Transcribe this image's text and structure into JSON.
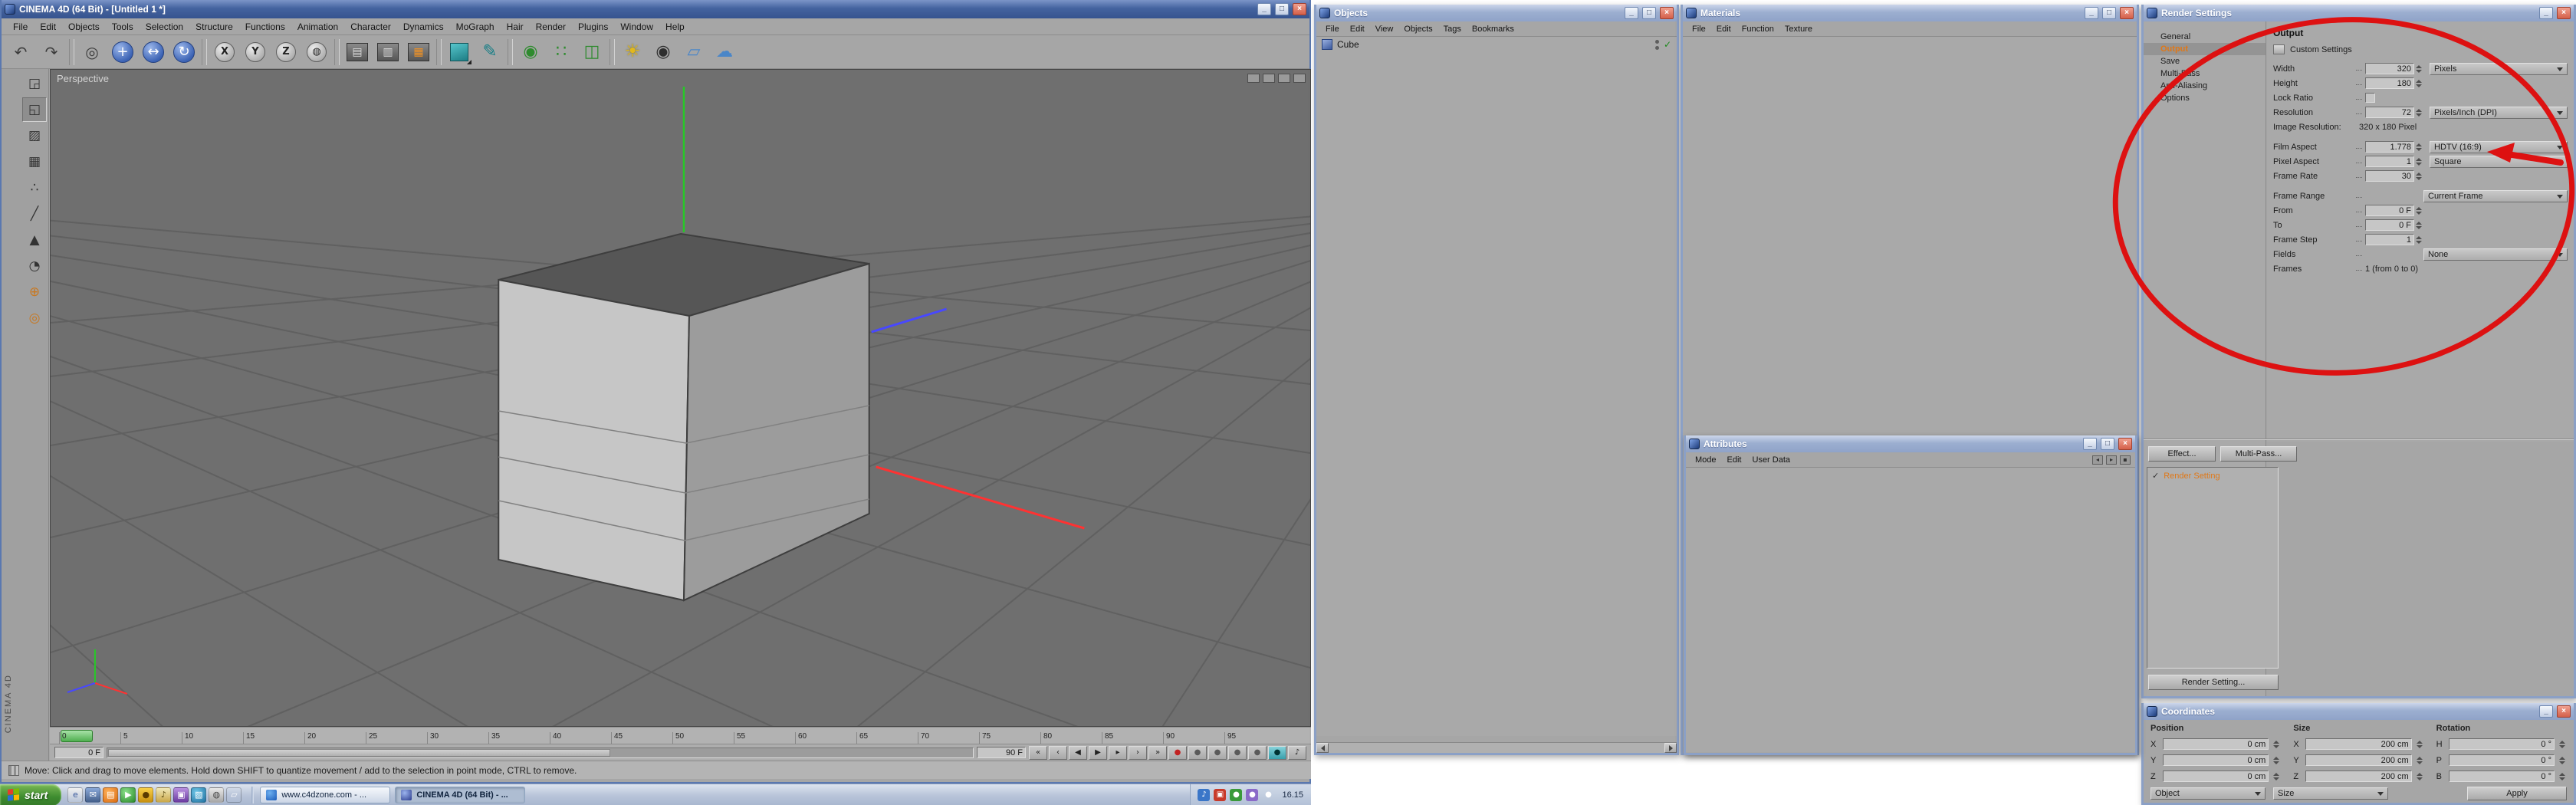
{
  "chrome": {
    "minimize_glyph": "_",
    "maximize_glyph": "□",
    "close_glyph": "×"
  },
  "icons": {
    "check": "✓"
  },
  "main_window": {
    "title": "CINEMA 4D (64 Bit) - [Untitled 1 *]",
    "menu_items": [
      "File",
      "Edit",
      "Objects",
      "Tools",
      "Selection",
      "Structure",
      "Functions",
      "Animation",
      "Character",
      "Dynamics",
      "MoGraph",
      "Hair",
      "Render",
      "Plugins",
      "Window",
      "Help"
    ],
    "toolbar_icons": [
      {
        "name": "undo-icon",
        "glyph": "↶"
      },
      {
        "name": "redo-icon",
        "glyph": "↷"
      },
      {
        "name": "separator",
        "glyph": "",
        "tint": "sep",
        "inter": "false"
      },
      {
        "name": "live-selection-icon",
        "glyph": "◎"
      },
      {
        "name": "move-tool-icon",
        "glyph": "+",
        "tint": "blue"
      },
      {
        "name": "scale-tool-icon",
        "glyph": "↔",
        "tint": "blue"
      },
      {
        "name": "rotate-tool-icon",
        "glyph": "↻",
        "tint": "blue"
      },
      {
        "name": "separator",
        "glyph": "",
        "tint": "sep",
        "inter": "false"
      },
      {
        "name": "x-axis-lock-icon",
        "glyph": "X",
        "tint": "ring"
      },
      {
        "name": "y-axis-lock-icon",
        "glyph": "Y",
        "tint": "ring"
      },
      {
        "name": "z-axis-lock-icon",
        "glyph": "Z",
        "tint": "ring"
      },
      {
        "name": "coordinate-system-icon",
        "glyph": "◍",
        "tint": "ring"
      },
      {
        "name": "separator",
        "glyph": "",
        "tint": "sep",
        "inter": "false"
      },
      {
        "name": "render-view-icon",
        "glyph": "▤",
        "tint": "render"
      },
      {
        "name": "render-picture-viewer-icon",
        "glyph": "▥",
        "tint": "render"
      },
      {
        "name": "render-settings-icon",
        "glyph": "▦",
        "tint": "render-orange"
      },
      {
        "name": "separator",
        "glyph": "",
        "tint": "sep",
        "inter": "false"
      },
      {
        "name": "cube-primitive-icon",
        "glyph": "■",
        "tint": "teal-cube"
      },
      {
        "name": "spline-pen-icon",
        "glyph": "✎",
        "tint": "teal"
      },
      {
        "name": "separator",
        "glyph": "",
        "tint": "sep",
        "inter": "false"
      },
      {
        "name": "hypernurbs-icon",
        "glyph": "◉",
        "tint": "green"
      },
      {
        "name": "array-icon",
        "glyph": "∷",
        "tint": "green"
      },
      {
        "name": "instance-icon",
        "glyph": "◫",
        "tint": "green"
      },
      {
        "name": "separator",
        "glyph": "",
        "tint": "sep",
        "inter": "false"
      },
      {
        "name": "light-icon",
        "glyph": "☀",
        "tint": "yellow"
      },
      {
        "name": "camera-icon",
        "glyph": "◉",
        "tint": "dark"
      },
      {
        "name": "floor-icon",
        "glyph": "▱",
        "tint": "sky"
      },
      {
        "name": "sky-icon",
        "glyph": "☁",
        "tint": "sky"
      }
    ],
    "left_toolbar_icons": [
      {
        "name": "make-editable-icon",
        "glyph": "◲"
      },
      {
        "name": "model-mode-icon",
        "glyph": "◱",
        "tint": "active"
      },
      {
        "name": "texture-mode-icon",
        "glyph": "▨"
      },
      {
        "name": "workplane-mode-icon",
        "glyph": "▦"
      },
      {
        "name": "points-mode-icon",
        "glyph": "∴"
      },
      {
        "name": "edges-mode-icon",
        "glyph": "╱"
      },
      {
        "name": "polygons-mode-icon",
        "glyph": "▲"
      },
      {
        "name": "animation-mode-icon",
        "glyph": "◔"
      },
      {
        "name": "axis-mode-icon",
        "glyph": "⊕",
        "tint": "orange"
      },
      {
        "name": "snap-settings-icon",
        "glyph": "◎",
        "tint": "orange"
      }
    ],
    "viewport": {
      "label": "Perspective"
    },
    "vertical_brand": "CINEMA 4D",
    "timeline_ticks": [
      "0",
      "5",
      "10",
      "15",
      "20",
      "25",
      "30",
      "35",
      "40",
      "45",
      "50",
      "55",
      "60",
      "65",
      "70",
      "75",
      "80",
      "85",
      "90",
      "95"
    ],
    "transport": {
      "current_frame": "0 F",
      "end_frame": "90 F",
      "buttons": [
        {
          "name": "goto-start-button",
          "glyph": "«"
        },
        {
          "name": "previous-key-button",
          "glyph": "‹"
        },
        {
          "name": "previous-frame-button",
          "glyph": "◀"
        },
        {
          "name": "play-button",
          "glyph": "▶"
        },
        {
          "name": "next-frame-button",
          "glyph": "▸"
        },
        {
          "name": "next-key-button",
          "glyph": "›"
        },
        {
          "name": "goto-end-button",
          "glyph": "»"
        },
        {
          "name": "record-keyframe-button",
          "glyph": "●",
          "tint": "red"
        },
        {
          "name": "record-position-button",
          "glyph": "●",
          "tint": "gray"
        },
        {
          "name": "record-scale-button",
          "glyph": "●",
          "tint": "gray"
        },
        {
          "name": "record-rotation-button",
          "glyph": "●",
          "tint": "gray"
        },
        {
          "name": "record-parameter-button",
          "glyph": "●",
          "tint": "gray"
        },
        {
          "name": "autokey-button",
          "glyph": "●",
          "tint": "teal"
        },
        {
          "name": "play-sound-button",
          "glyph": "♪"
        }
      ]
    },
    "status_text": "Move: Click and drag to move elements. Hold down SHIFT to quantize movement / add to the selection in point mode, CTRL to remove."
  },
  "objects_window": {
    "title": "Objects",
    "menu_items": [
      "File",
      "Edit",
      "View",
      "Objects",
      "Tags",
      "Bookmarks"
    ],
    "items": [
      {
        "label": "Cube"
      }
    ]
  },
  "materials_window": {
    "title": "Materials",
    "menu_items": [
      "File",
      "Edit",
      "Function",
      "Texture"
    ]
  },
  "attributes_window": {
    "title": "Attributes",
    "menu_items": [
      "Mode",
      "Edit",
      "User Data"
    ]
  },
  "render_settings": {
    "title": "Render Settings",
    "nav_items": [
      "General",
      "Output",
      "Save",
      "Multi-Pass",
      "Anti-Aliasing",
      "Options"
    ],
    "page_title": "Output",
    "custom_settings_label": "Custom Settings",
    "fields": {
      "width": {
        "label": "Width",
        "value": "320",
        "unit": "Pixels"
      },
      "height": {
        "label": "Height",
        "value": "180"
      },
      "lock_ratio": {
        "label": "Lock Ratio"
      },
      "resolution": {
        "label": "Resolution",
        "value": "72",
        "unit": "Pixels/Inch (DPI)"
      },
      "image_resolution": {
        "label": "Image Resolution:",
        "value": "320 x 180 Pixel"
      },
      "film_aspect": {
        "label": "Film Aspect",
        "value": "1.778",
        "preset": "HDTV (16:9)"
      },
      "pixel_aspect": {
        "label": "Pixel Aspect",
        "value": "1",
        "preset": "Square"
      },
      "frame_rate": {
        "label": "Frame Rate",
        "value": "30"
      },
      "frame_range": {
        "label": "Frame Range",
        "value": "Current Frame"
      },
      "from": {
        "label": "From",
        "value": "0 F"
      },
      "to": {
        "label": "To",
        "value": "0 F"
      },
      "frame_step": {
        "label": "Frame Step",
        "value": "1"
      },
      "fields": {
        "label": "Fields",
        "value": "None"
      },
      "frames": {
        "label": "Frames",
        "value": "1 (from 0 to 0)"
      }
    },
    "effect_button": "Effect...",
    "multipass_button": "Multi-Pass...",
    "presets": [
      {
        "label": "Render Setting"
      }
    ],
    "new_setting_button": "Render Setting..."
  },
  "coordinates_window": {
    "title": "Coordinates",
    "columns": [
      {
        "header": "Position",
        "rows": [
          {
            "axis": "X",
            "value": "0 cm"
          },
          {
            "axis": "Y",
            "value": "0 cm"
          },
          {
            "axis": "Z",
            "value": "0 cm"
          }
        ]
      },
      {
        "header": "Size",
        "rows": [
          {
            "axis": "X",
            "value": "200 cm"
          },
          {
            "axis": "Y",
            "value": "200 cm"
          },
          {
            "axis": "Z",
            "value": "200 cm"
          }
        ]
      },
      {
        "header": "Rotation",
        "rows": [
          {
            "axis": "H",
            "value": "0 °"
          },
          {
            "axis": "P",
            "value": "0 °"
          },
          {
            "axis": "B",
            "value": "0 °"
          }
        ]
      }
    ],
    "object_dropdown": "Object",
    "size_dropdown": "Size",
    "apply_button": "Apply"
  },
  "taskbar": {
    "start_label": "start",
    "quick_launch": [
      {
        "name": "ie-icon",
        "glyph": "e"
      },
      {
        "name": "mail-icon",
        "glyph": "✉"
      },
      {
        "name": "show-desktop-icon",
        "glyph": "▤"
      },
      {
        "name": "media-player-icon",
        "glyph": "▶"
      },
      {
        "name": "messenger-icon",
        "glyph": "●"
      },
      {
        "name": "music-player-icon",
        "glyph": "♪"
      },
      {
        "name": "folder-icon",
        "glyph": "▣"
      },
      {
        "name": "photo-viewer-icon",
        "glyph": "▧"
      },
      {
        "name": "browser-icon",
        "glyph": "◍"
      },
      {
        "name": "document-icon",
        "glyph": "▱"
      }
    ],
    "tasks": [
      {
        "label": "www.c4dzone.com - ..."
      },
      {
        "label": "CINEMA 4D (64 Bit) - ..."
      }
    ],
    "tray_icons": [
      {
        "name": "volume-icon",
        "glyph": "♪"
      },
      {
        "name": "network-icon",
        "glyph": "▣"
      },
      {
        "name": "antivirus-icon",
        "glyph": "●"
      },
      {
        "name": "messenger-status-icon",
        "glyph": "●"
      },
      {
        "name": "update-icon",
        "glyph": "●"
      }
    ],
    "clock": "16.15"
  }
}
